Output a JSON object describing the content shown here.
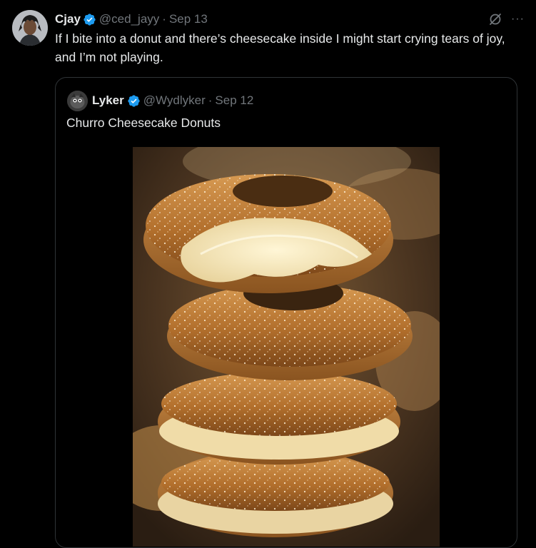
{
  "tweet": {
    "display_name": "Cjay",
    "handle": "@ced_jayy",
    "separator": "·",
    "date": "Sep 13",
    "text": "If I bite into a donut and there’s cheesecake inside I might start crying tears of joy, and I’m not playing.",
    "more_label": "···"
  },
  "quote": {
    "display_name": "Lyker",
    "handle": "@Wydlyker",
    "separator": "·",
    "date": "Sep 12",
    "text": "Churro Cheesecake Donuts"
  },
  "icons": {
    "verified": "verified-badge-icon",
    "grok": "grok-icon",
    "more": "more-icon"
  },
  "colors": {
    "background": "#000000",
    "text_primary": "#e7e9ea",
    "text_secondary": "#71767b",
    "verified_blue": "#1d9bf0",
    "border": "#2f3336"
  }
}
